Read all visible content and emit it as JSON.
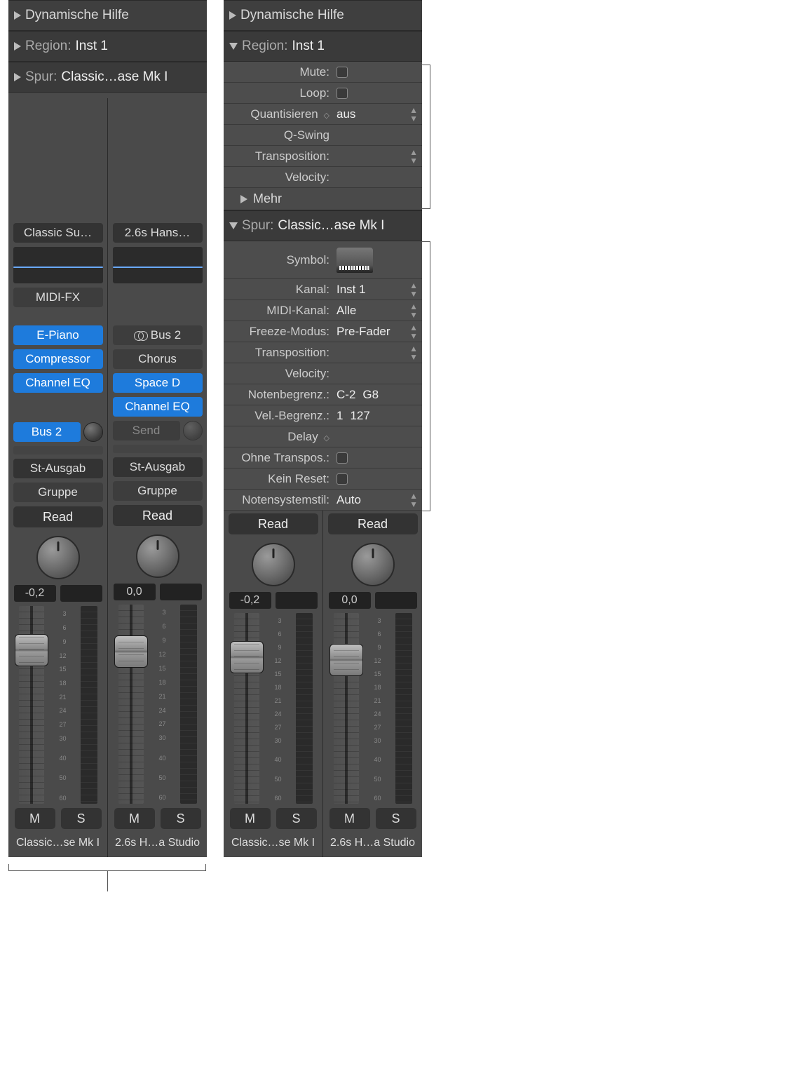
{
  "left": {
    "help": "Dynamische Hilfe",
    "region_label": "Region:",
    "region_value": "Inst 1",
    "track_label": "Spur:",
    "track_value": "Classic…ase Mk I",
    "strips": [
      {
        "setting": "Classic Su…",
        "midifx": "MIDI-FX",
        "instrument": "E-Piano",
        "inserts": [
          "Compressor",
          "Channel EQ"
        ],
        "send_label": "Bus 2",
        "output": "St-Ausgab",
        "group": "Gruppe",
        "auto": "Read",
        "db": "-0,2",
        "mute": "M",
        "solo": "S",
        "name": "Classic…se Mk I"
      },
      {
        "setting": "2.6s Hans…",
        "aux_in": "Bus 2",
        "inserts": [
          "Chorus",
          "Space D",
          "Channel EQ"
        ],
        "send_label": "Send",
        "output": "St-Ausgab",
        "group": "Gruppe",
        "auto": "Read",
        "db": "0,0",
        "mute": "M",
        "solo": "S",
        "name": "2.6s H…a Studio"
      }
    ]
  },
  "right": {
    "help": "Dynamische Hilfe",
    "region_label": "Region:",
    "region_value": "Inst 1",
    "region_params": {
      "mute": "Mute:",
      "loop": "Loop:",
      "quant_label": "Quantisieren",
      "quant_value": "aus",
      "qswing": "Q-Swing",
      "transp": "Transposition:",
      "velocity": "Velocity:",
      "more": "Mehr"
    },
    "track_label": "Spur:",
    "track_value": "Classic…ase Mk I",
    "track_params": {
      "symbol": "Symbol:",
      "kanal_l": "Kanal:",
      "kanal_v": "Inst 1",
      "midik_l": "MIDI-Kanal:",
      "midik_v": "Alle",
      "freeze_l": "Freeze-Modus:",
      "freeze_v": "Pre-Fader",
      "transp": "Transposition:",
      "velocity": "Velocity:",
      "notelim_l": "Notenbegrenz.:",
      "notelim_lo": "C-2",
      "notelim_hi": "G8",
      "vellim_l": "Vel.-Begrenz.:",
      "vellim_lo": "1",
      "vellim_hi": "127",
      "delay": "Delay",
      "notransp": "Ohne Transpos.:",
      "noreset": "Kein Reset:",
      "staff_l": "Notensystemstil:",
      "staff_v": "Auto"
    },
    "strips": [
      {
        "auto": "Read",
        "db": "-0,2",
        "mute": "M",
        "solo": "S",
        "name": "Classic…se Mk I"
      },
      {
        "auto": "Read",
        "db": "0,0",
        "mute": "M",
        "solo": "S",
        "name": "2.6s H…a Studio"
      }
    ]
  },
  "fader_scale": [
    "",
    "3",
    "6",
    "9",
    "12",
    "15",
    "18",
    "21",
    "24",
    "27",
    "30",
    "40",
    "50",
    "60"
  ]
}
